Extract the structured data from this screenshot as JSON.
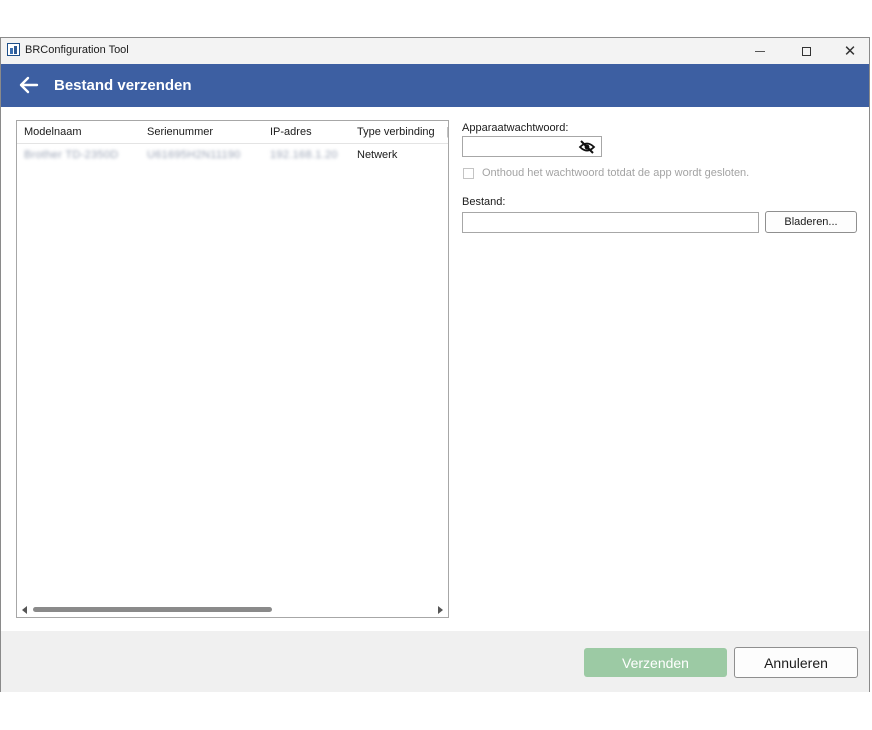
{
  "window": {
    "title": "BRConfiguration Tool"
  },
  "header": {
    "title": "Bestand verzenden"
  },
  "device_table": {
    "columns": [
      "Modelnaam",
      "Serienummer",
      "IP-adres",
      "Type verbinding",
      ""
    ],
    "rows": [
      {
        "model": "Brother TD-2350D",
        "serial": "U61695H2N11190",
        "ip": "192.168.1.20",
        "connection": "Netwerk",
        "extra": ""
      }
    ]
  },
  "password": {
    "label": "Apparaatwachtwoord:",
    "value": ""
  },
  "remember": {
    "label": "Onthoud het wachtwoord totdat de app wordt gesloten.",
    "checked": false
  },
  "file": {
    "label": "Bestand:",
    "value": "",
    "browse_label": "Bladeren..."
  },
  "footer": {
    "send_label": "Verzenden",
    "cancel_label": "Annuleren"
  },
  "colors": {
    "header": "#3d5fa2",
    "send_disabled": "#9ccaa4"
  },
  "icons": {
    "back": "arrow-left-icon",
    "password_visibility": "eye-slash-icon",
    "app": "app-icon"
  }
}
